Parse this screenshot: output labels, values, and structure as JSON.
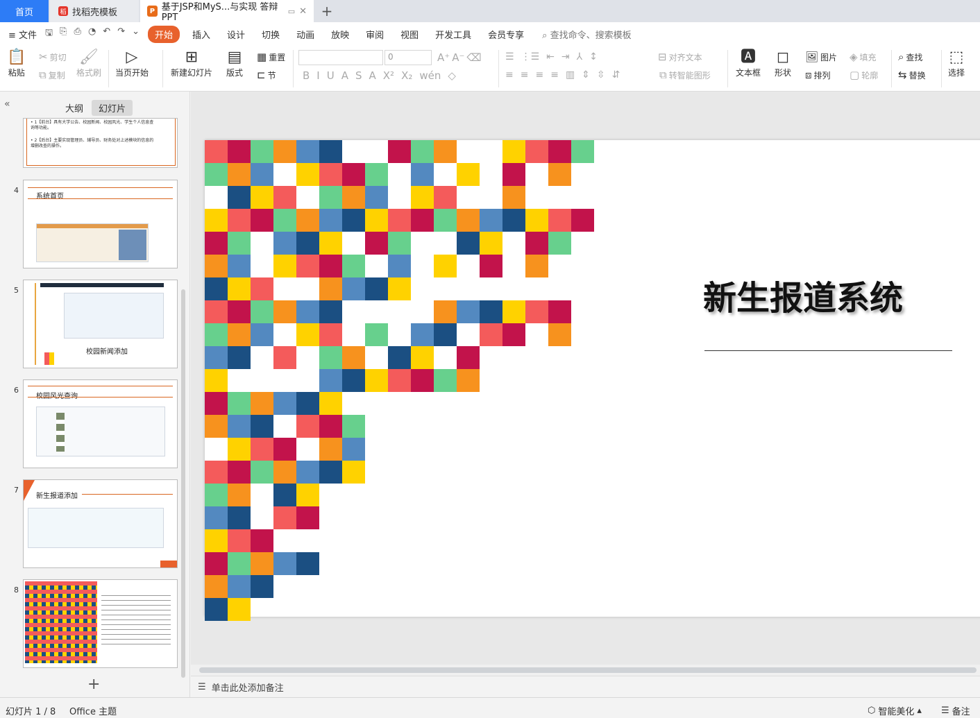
{
  "tabs": {
    "home": "首页",
    "template": "找稻壳模板",
    "doc": "基于JSP和MyS...与实现 答辩PPT"
  },
  "menu": {
    "file": "文件",
    "items": [
      "开始",
      "插入",
      "设计",
      "切换",
      "动画",
      "放映",
      "审阅",
      "视图",
      "开发工具",
      "会员专享"
    ],
    "search": "查找命令、搜索模板"
  },
  "ribbon": {
    "paste": "粘贴",
    "cut": "剪切",
    "copy": "复制",
    "format_painter": "格式刷",
    "from_start": "当页开始",
    "new_slide": "新建幻灯片",
    "layout": "版式",
    "reset": "重置",
    "section": "节",
    "font_size": "0",
    "convert_smartart": "转智能图形",
    "align_text": "对齐文本",
    "textbox": "文本框",
    "shape": "形状",
    "picture": "图片",
    "arrange": "排列",
    "fill": "填充",
    "outline": "轮廓",
    "find": "查找",
    "replace": "替换",
    "select": "选择"
  },
  "pane": {
    "outline_tab": "大纲",
    "slides_tab": "幻灯片"
  },
  "thumbnails": [
    {
      "num": "",
      "lines": [
        "• 1【前台】具有大学公告、校园新闻、校园风光、学生个人信息查询等功能。",
        "• 2【后台】主要实现管理员、辅导员、财务处对上述模块的信息的增删改查的操作。"
      ]
    },
    {
      "num": "4",
      "title": "系统首页"
    },
    {
      "num": "5",
      "title": "校园新闻添加"
    },
    {
      "num": "6",
      "title": "校园风光查询"
    },
    {
      "num": "7",
      "title": "新生报道添加"
    },
    {
      "num": "8",
      "title": ""
    }
  ],
  "slide": {
    "title": "新生报道系统"
  },
  "notes": "单击此处添加备注",
  "status": {
    "slide_count": "幻灯片 1 / 8",
    "theme": "Office 主题",
    "beautify": "智能美化",
    "notes_btn": "备注"
  },
  "colors": {
    "red": "#f45b5b",
    "orange": "#f7921e",
    "yellow": "#ffd200",
    "green": "#67d08d",
    "navy": "#1b4f82",
    "crimson": "#c2134b",
    "blue": "#5389c0",
    "accent": "#e8612c"
  }
}
